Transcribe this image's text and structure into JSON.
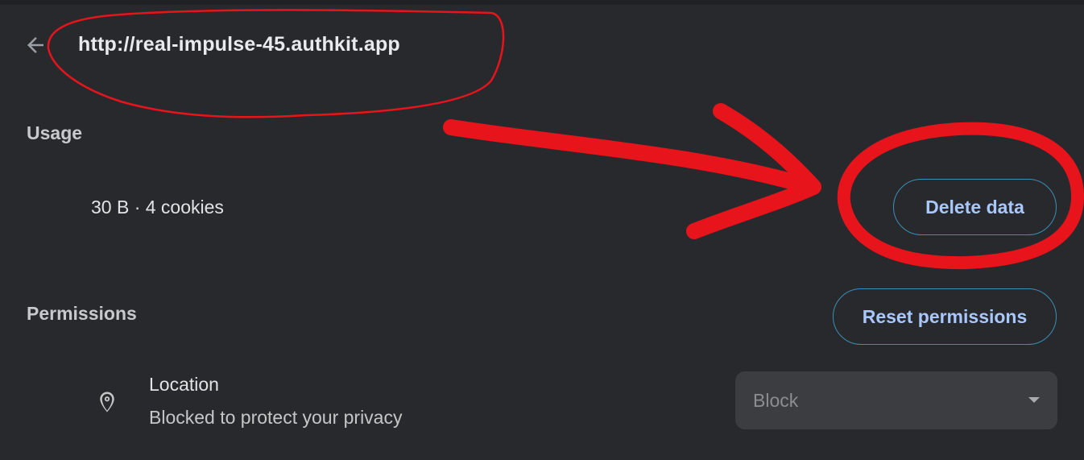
{
  "header": {
    "back_icon": "arrow-left-icon",
    "site_url": "http://real-impulse-45.authkit.app"
  },
  "usage": {
    "heading": "Usage",
    "summary": "30 B · 4 cookies",
    "delete_label": "Delete data"
  },
  "permissions": {
    "heading": "Permissions",
    "reset_label": "Reset permissions",
    "items": [
      {
        "icon": "location-pin-icon",
        "label": "Location",
        "sublabel": "Blocked to protect your privacy",
        "value": "Block"
      }
    ]
  },
  "colors": {
    "background": "#28292d",
    "accent_text": "#a8c7fa",
    "button_border": "#3b8fb5",
    "annotation_red": "#e8141b"
  }
}
